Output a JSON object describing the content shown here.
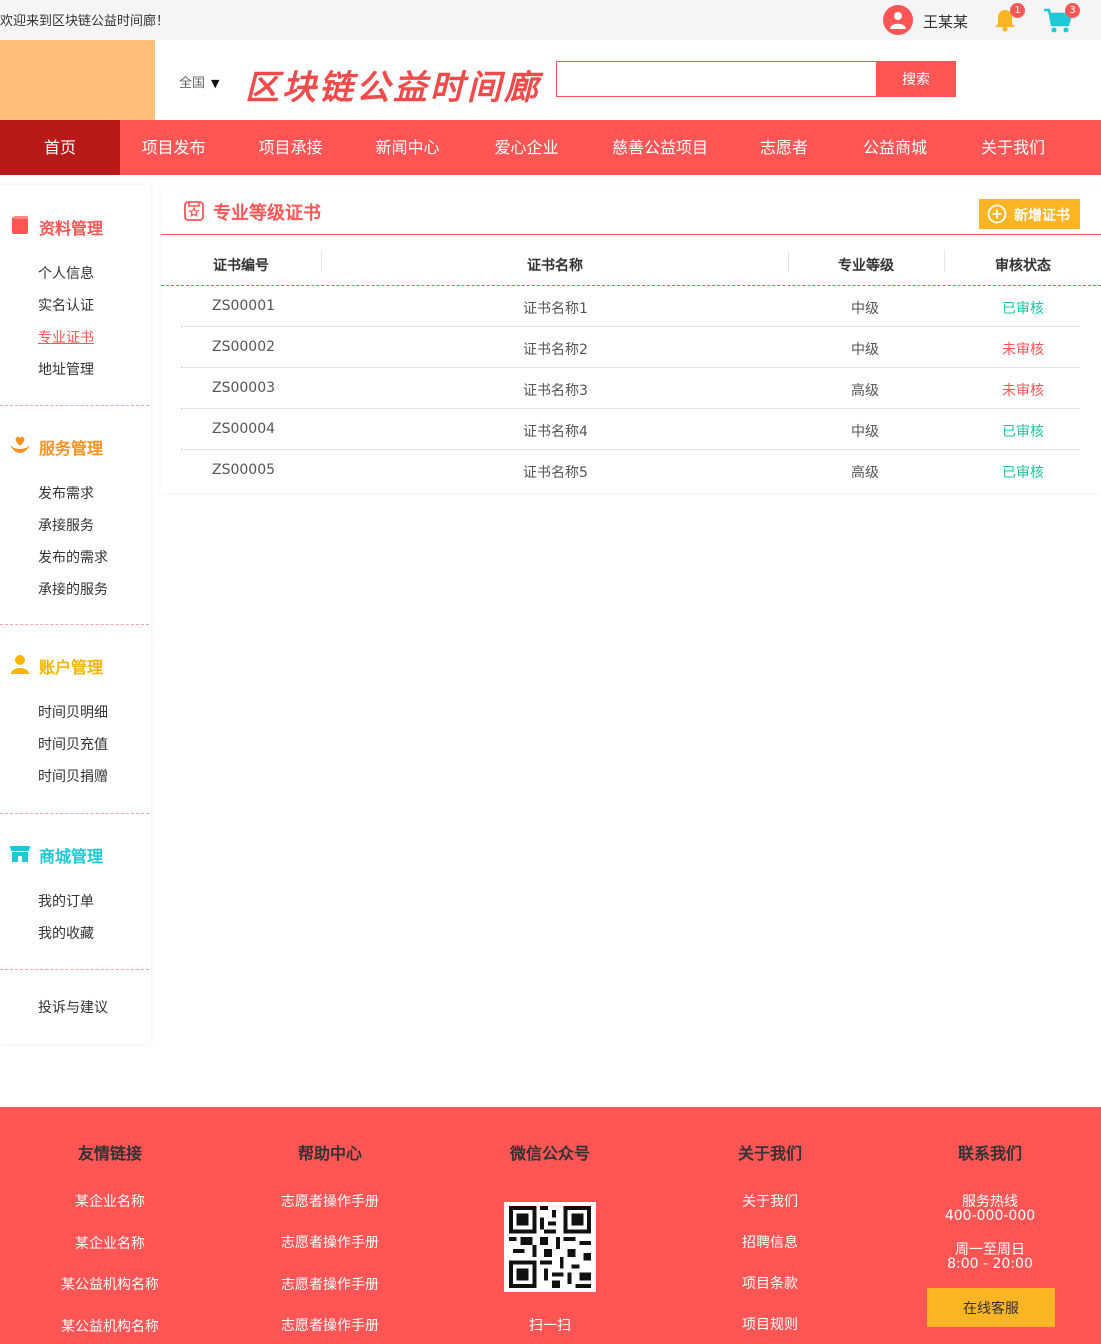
{
  "topbar": {
    "welcome": "欢迎来到区块链公益时间廊！",
    "username": "王某某",
    "bell_count": "1",
    "cart_count": "3"
  },
  "header": {
    "region": "全国",
    "brand": "区块链公益时间廊",
    "search_placeholder": "",
    "search_button": "搜索"
  },
  "nav": {
    "items": [
      "首页",
      "项目发布",
      "项目承接",
      "新闻中心",
      "爱心企业",
      "慈善公益项目",
      "志愿者",
      "公益商城",
      "关于我们"
    ]
  },
  "sidebar": {
    "groups": [
      {
        "title": "资料管理",
        "color": "#f55",
        "icon": "book-icon",
        "items": [
          "个人信息",
          "实名认证",
          "专业证书",
          "地址管理"
        ]
      },
      {
        "title": "服务管理",
        "color": "#f7931e",
        "icon": "heart-hand-icon",
        "items": [
          "发布需求",
          "承接服务",
          "发布的需求",
          "承接的服务"
        ]
      },
      {
        "title": "账户管理",
        "color": "#f7b500",
        "icon": "user-icon",
        "items": [
          "时间贝明细",
          "时间贝充值",
          "时间贝捐赠"
        ]
      },
      {
        "title": "商城管理",
        "color": "#1ec8d6",
        "icon": "store-icon",
        "items": [
          "我的订单",
          "我的收藏"
        ]
      }
    ],
    "extra": "投诉与建议",
    "active_item": "专业证书"
  },
  "content": {
    "title": "专业等级证书",
    "add_button": "新增证书",
    "columns": [
      "证书编号",
      "证书名称",
      "专业等级",
      "审核状态"
    ],
    "rows": [
      {
        "id": "ZS00001",
        "name": "证书名称1",
        "level": "中级",
        "status": "已审核"
      },
      {
        "id": "ZS00002",
        "name": "证书名称2",
        "level": "中级",
        "status": "未审核"
      },
      {
        "id": "ZS00003",
        "name": "证书名称3",
        "level": "高级",
        "status": "未审核"
      },
      {
        "id": "ZS00004",
        "name": "证书名称4",
        "level": "中级",
        "status": "已审核"
      },
      {
        "id": "ZS00005",
        "name": "证书名称5",
        "level": "高级",
        "status": "已审核"
      }
    ]
  },
  "footer": {
    "friends": {
      "title": "友情链接",
      "links": [
        "某企业名称",
        "某企业名称",
        "某公益机构名称",
        "某公益机构名称"
      ]
    },
    "help": {
      "title": "帮助中心",
      "links": [
        "志愿者操作手册",
        "志愿者操作手册",
        "志愿者操作手册",
        "志愿者操作手册"
      ]
    },
    "wechat": {
      "title": "微信公众号",
      "scan": "扫一扫"
    },
    "about": {
      "title": "关于我们",
      "links": [
        "关于我们",
        "招聘信息",
        "项目条款",
        "项目规则"
      ]
    },
    "contact": {
      "title": "联系我们",
      "hotline_label": "服务热线",
      "hotline": "400-000-000",
      "days": "周一至周日",
      "hours": "8:00 - 20:00",
      "service_button": "在线客服"
    }
  },
  "colors": {
    "brand_red": "#f55",
    "nav_active": "#b81a1a",
    "accent_yellow": "#fbb424",
    "ok_green": "#19c9a2",
    "logo_orange": "#ffbd7a"
  }
}
